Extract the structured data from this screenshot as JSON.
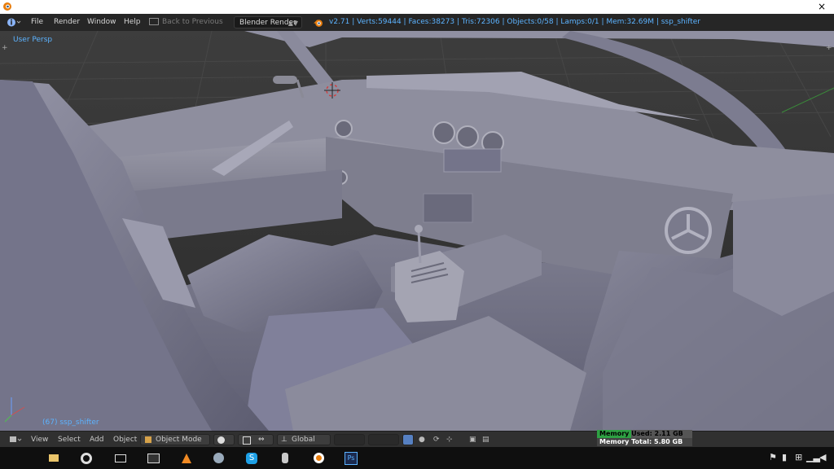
{
  "window": {
    "close_glyph": "×"
  },
  "menubar": {
    "items": [
      "File",
      "Render",
      "Window",
      "Help"
    ],
    "back_label": "Back to Previous",
    "render_engine": "Blender Render",
    "stats": "v2.71 | Verts:59444 | Faces:38273 | Tris:72306 | Objects:0/58 | Lamps:0/1 | Mem:32.69M | ssp_shifter"
  },
  "viewport": {
    "view_name": "User Persp",
    "object_label": "(67) ssp_shifter"
  },
  "bottom_bar": {
    "menu": [
      "View",
      "Select",
      "Add",
      "Object"
    ],
    "mode": "Object Mode",
    "orientation": "Global"
  },
  "memory": {
    "used": "Memory Used: 2.11 GB",
    "total": "Memory Total: 5.80 GB",
    "used_fraction": 0.36
  },
  "colors": {
    "accent_blue": "#5cb3ff",
    "blender_orange": "#e87d0d",
    "memory_green": "#2ea043"
  },
  "taskbar": {
    "icons": [
      "file-explorer-icon",
      "chrome-icon",
      "desktop-icon",
      "terminal-icon",
      "vlc-icon",
      "steam-icon",
      "skype-icon",
      "game-icon",
      "blender-icon",
      "photoshop-icon"
    ]
  },
  "tray": {
    "icons": [
      "flag-icon",
      "battery-icon",
      "network-icon",
      "signal-icon",
      "volume-icon"
    ]
  }
}
